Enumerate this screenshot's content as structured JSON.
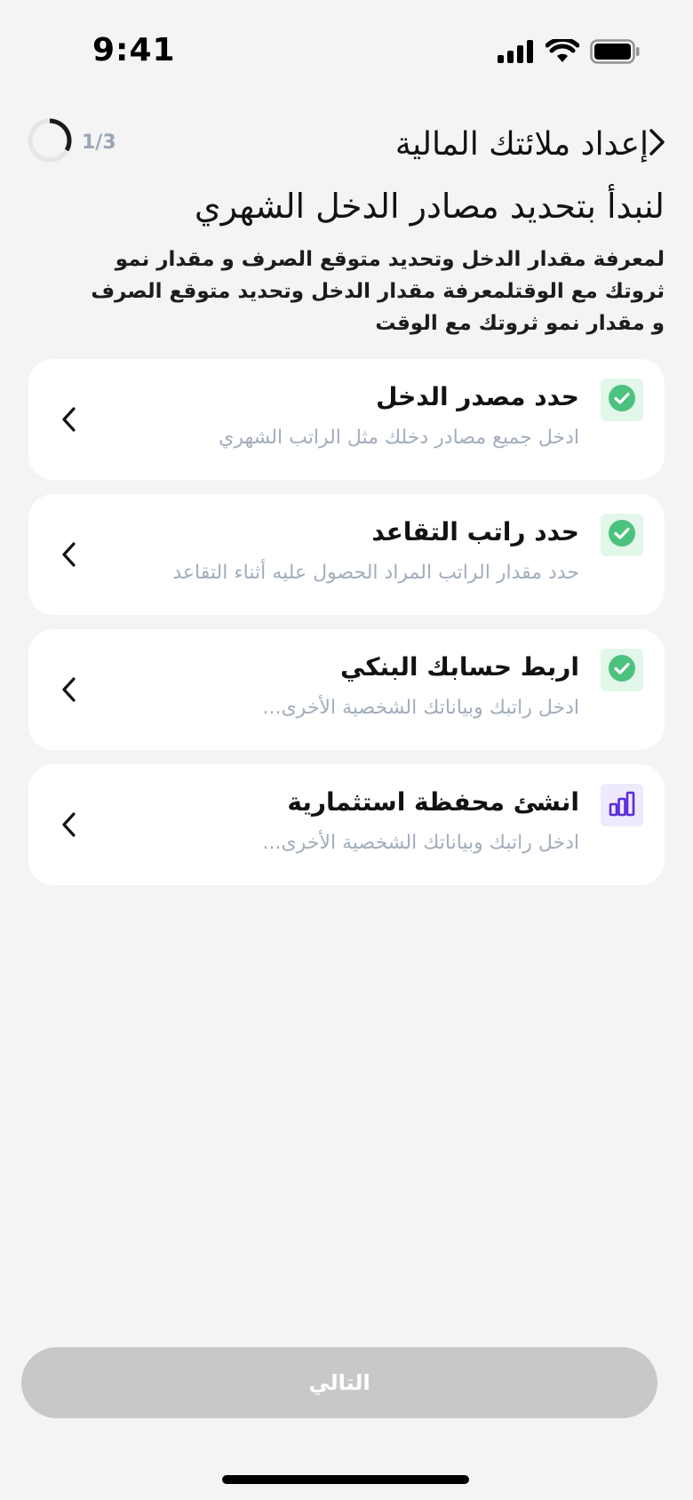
{
  "status_bar": {
    "time": "9:41"
  },
  "header": {
    "title": "إعداد ملائتك المالية",
    "progress_text": "1/3",
    "progress_fraction": 0.333
  },
  "headline": "لنبدأ بتحديد مصادر الدخل الشهري",
  "description": "لمعرفة مقدار الدخل وتحديد متوقع الصرف و مقدار نمو ثروتك مع الوقتلمعرفة مقدار الدخل وتحديد متوقع الصرف و مقدار نمو ثروتك مع الوقت",
  "steps": [
    {
      "title": "حدد مصدر الدخل",
      "subtitle": "ادخل جميع مصادر دخلك مثل الراتب الشهري",
      "status": "done",
      "icon": "check-circle-icon"
    },
    {
      "title": "حدد راتب التقاعد",
      "subtitle": "حدد مقدار الراتب المراد الحصول عليه أثناء التقاعد",
      "status": "done",
      "icon": "check-circle-icon"
    },
    {
      "title": "اربط حسابك البنكي",
      "subtitle": "ادخل راتبك وبياناتك الشخصية الأخرى...",
      "status": "done",
      "icon": "check-circle-icon"
    },
    {
      "title": "انشئ محفظة استثمارية",
      "subtitle": "ادخل راتبك وبياناتك الشخصية الأخرى...",
      "status": "pending",
      "icon": "bar-chart-icon"
    }
  ],
  "next_button": {
    "label": "التالي",
    "enabled": false
  },
  "colors": {
    "background": "#f4f4f4",
    "success": "#4cc27f",
    "success_bg": "#e3f6ea",
    "accent": "#5b2bd9",
    "accent_bg": "#eeeafc",
    "muted_text": "#a3adbd",
    "disabled_button": "#c8c8c8"
  }
}
